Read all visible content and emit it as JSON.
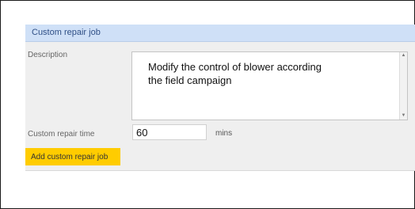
{
  "panel": {
    "title": "Custom repair job"
  },
  "description": {
    "label": "Description",
    "value": "Modify the control of blower according\nthe field campaign"
  },
  "repair_time": {
    "label": "Custom repair time",
    "value": "60",
    "unit": "mins"
  },
  "actions": {
    "add_label": "Add custom repair job"
  },
  "colors": {
    "header_bg": "#cfe0f7",
    "header_text": "#2f4f86",
    "panel_bg": "#efefef",
    "button_bg": "#ffcc00"
  }
}
